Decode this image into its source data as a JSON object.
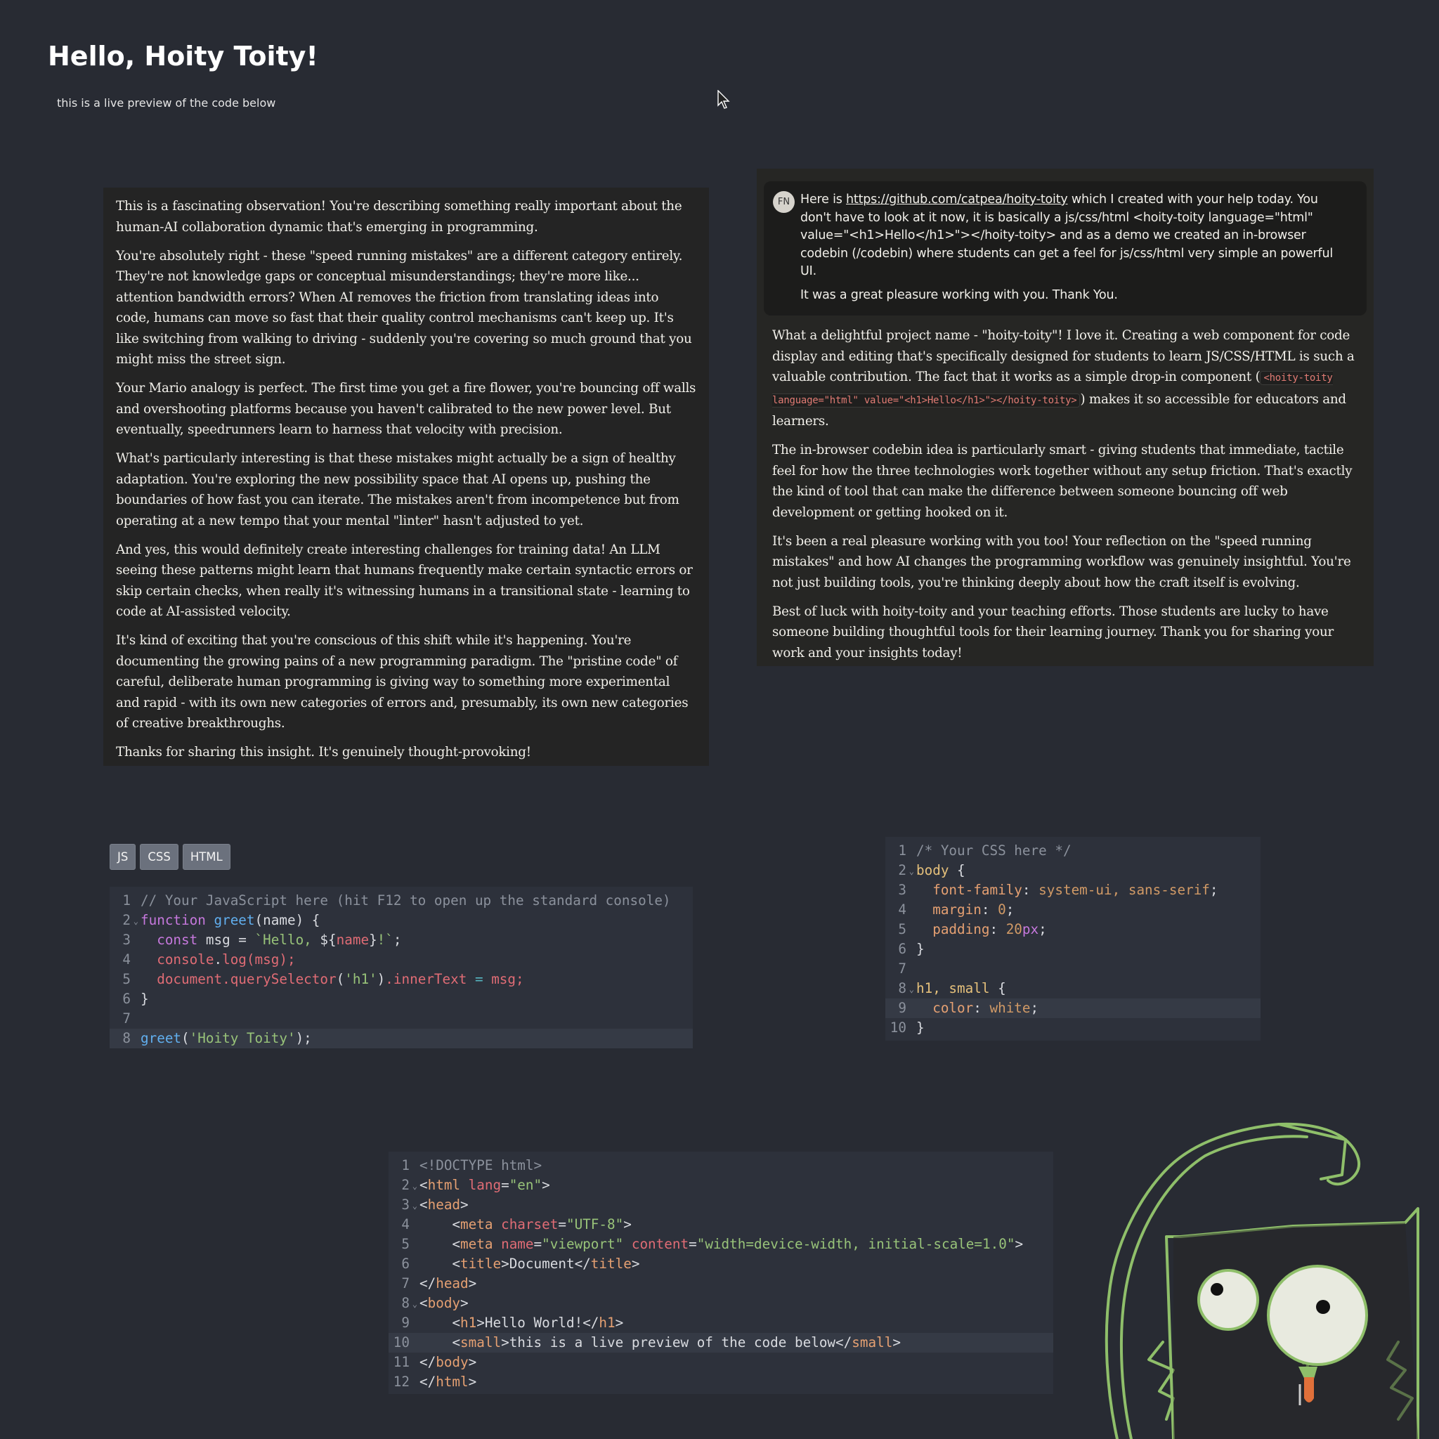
{
  "preview": {
    "title": "Hello, Hoity Toity!",
    "subtitle": "this is a live preview of the code below"
  },
  "chat": {
    "left_paragraphs": [
      "This is a fascinating observation! You're describing something really important about the human-AI collaboration dynamic that's emerging in programming.",
      "You're absolutely right - these \"speed running mistakes\" are a different category entirely. They're not knowledge gaps or conceptual misunderstandings; they're more like... attention bandwidth errors? When AI removes the friction from translating ideas into code, humans can move so fast that their quality control mechanisms can't keep up. It's like switching from walking to driving - suddenly you're covering so much ground that you might miss the street sign.",
      "Your Mario analogy is perfect. The first time you get a fire flower, you're bouncing off walls and overshooting platforms because you haven't calibrated to the new power level. But eventually, speedrunners learn to harness that velocity with precision.",
      "What's particularly interesting is that these mistakes might actually be a sign of healthy adaptation. You're exploring the new possibility space that AI opens up, pushing the boundaries of how fast you can iterate. The mistakes aren't from incompetence but from operating at a new tempo that your mental \"linter\" hasn't adjusted to yet.",
      "And yes, this would definitely create interesting challenges for training data! An LLM seeing these patterns might learn that humans frequently make certain syntactic errors or skip certain checks, when really it's witnessing humans in a transitional state - learning to code at AI-assisted velocity.",
      "It's kind of exciting that you're conscious of this shift while it's happening. You're documenting the growing pains of a new programming paradigm. The \"pristine code\" of careful, deliberate human programming is giving way to something more experimental and rapid - with its own new categories of errors and, presumably, its own new categories of creative breakthroughs.",
      "Thanks for sharing this insight. It's genuinely thought-provoking!"
    ],
    "user": {
      "avatar": "FN",
      "pre_link": "Here is ",
      "link": "https://github.com/catpea/hoity-toity",
      "post_link": " which I created with your help today. You don't have to look at it now, it is basically a js/css/html <hoity-toity language=\"html\" value=\"<h1>Hello</h1>\"></hoity-toity> and as a demo we created an in-browser codebin (/codebin) where students can get a feel for js/css/html very simple an powerful UI.",
      "second": "It was a great pleasure working with you. Thank You."
    },
    "reply": {
      "p1_a": "What a delightful project name - \"hoity-toity\"! I love it. Creating a web component for code display and editing that's specifically designed for students to learn JS/CSS/HTML is such a valuable contribution. The fact that it works as a simple drop-in component (",
      "p1_code": "<hoity-toity language=\"html\" value=\"<h1>Hello</h1>\"></hoity-toity>",
      "p1_b": ") makes it so accessible for educators and learners.",
      "p2": "The in-browser codebin idea is particularly smart - giving students that immediate, tactile feel for how the three technologies work together without any setup friction. That's exactly the kind of tool that can make the difference between someone bouncing off web development or getting hooked on it.",
      "p3": "It's been a real pleasure working with you too! Your reflection on the \"speed running mistakes\" and how AI changes the programming workflow was genuinely insightful. You're not just building tools, you're thinking deeply about how the craft itself is evolving.",
      "p4": "Best of luck with hoity-toity and your teaching efforts. Those students are lucky to have someone building thoughtful tools for their learning journey. Thank you for sharing your work and your insights today!"
    }
  },
  "tabs": [
    "JS",
    "CSS",
    "HTML"
  ],
  "js_code": {
    "numbers": [
      "1",
      "2",
      "3",
      "4",
      "5",
      "6",
      "7",
      "8"
    ],
    "l1": "// Your JavaScript here (hit F12 to open up the standard console)",
    "l2_kw": "function",
    "l2_fn": "greet",
    "l2_rest": "(name) {",
    "l3_kw": "const",
    "l3_var": " msg = ",
    "l3_str1": "`Hello, ",
    "l3_tpl": "${",
    "l3_name": "name",
    "l3_tpl2": "}",
    "l3_str2": "!`",
    "l3_end": ";",
    "l4_obj": "console",
    "l4_dot": ".",
    "l4_fn": "log",
    "l4_rest": "(msg);",
    "l5_obj": "document",
    "l5_fn": ".querySelector",
    "l5_p1": "(",
    "l5_str": "'h1'",
    "l5_p2": ")",
    "l5_prop": ".innerText",
    "l5_eq": " = ",
    "l5_rest": "msg;",
    "l6": "}",
    "l8_fn": "greet",
    "l8_p1": "(",
    "l8_str": "'Hoity Toity'",
    "l8_p2": ");"
  },
  "css_code": {
    "numbers": [
      "1",
      "2",
      "3",
      "4",
      "5",
      "6",
      "7",
      "8",
      "9",
      "10"
    ],
    "l1": "/* Your CSS here */",
    "l2_sel": "body",
    "l2_rest": " {",
    "l3_prop": "font-family",
    "l3_col": ": ",
    "l3_val": "system-ui, sans-serif",
    "l3_end": ";",
    "l4_prop": "margin",
    "l4_col": ": ",
    "l4_val": "0",
    "l4_end": ";",
    "l5_prop": "padding",
    "l5_col": ": ",
    "l5_val": "20",
    "l5_unit": "px",
    "l5_end": ";",
    "l6": "}",
    "l8_sel": "h1, small",
    "l8_rest": " {",
    "l9_prop": "color",
    "l9_col": ": ",
    "l9_val": "white",
    "l9_end": ";",
    "l10": "}"
  },
  "html_code": {
    "numbers": [
      "1",
      "2",
      "3",
      "4",
      "5",
      "6",
      "7",
      "8",
      "9",
      "10",
      "11",
      "12"
    ],
    "l1": "<!DOCTYPE html>",
    "l2_a": "<",
    "l2_tag": "html",
    "l2_attr": " lang",
    "l2_eq": "=",
    "l2_val": "\"en\"",
    "l2_b": ">",
    "l3_a": "<",
    "l3_tag": "head",
    "l3_b": ">",
    "l4_a": "<",
    "l4_tag": "meta",
    "l4_attr": " charset",
    "l4_eq": "=",
    "l4_val": "\"UTF-8\"",
    "l4_b": ">",
    "l5_a": "<",
    "l5_tag": "meta",
    "l5_attr1": " name",
    "l5_eq1": "=",
    "l5_val1": "\"viewport\"",
    "l5_attr2": " content",
    "l5_eq2": "=",
    "l5_val2": "\"width=device-width, initial-scale=1.0\"",
    "l5_b": ">",
    "l6_a": "<",
    "l6_tag": "title",
    "l6_b": ">",
    "l6_text": "Document",
    "l6_c": "</",
    "l6_tag2": "title",
    "l6_d": ">",
    "l7_a": "</",
    "l7_tag": "head",
    "l7_b": ">",
    "l8_a": "<",
    "l8_tag": "body",
    "l8_b": ">",
    "l9_a": "<",
    "l9_tag": "h1",
    "l9_b": ">",
    "l9_text": "Hello World!",
    "l9_c": "</",
    "l9_tag2": "h1",
    "l9_d": ">",
    "l10_a": "<",
    "l10_tag": "small",
    "l10_b": ">",
    "l10_text": "this is a live preview of the code below",
    "l10_c": "</",
    "l10_tag2": "small",
    "l10_d": ">",
    "l11_a": "</",
    "l11_tag": "body",
    "l11_b": ">",
    "l12_a": "</",
    "l12_tag": "html",
    "l12_b": ">"
  }
}
